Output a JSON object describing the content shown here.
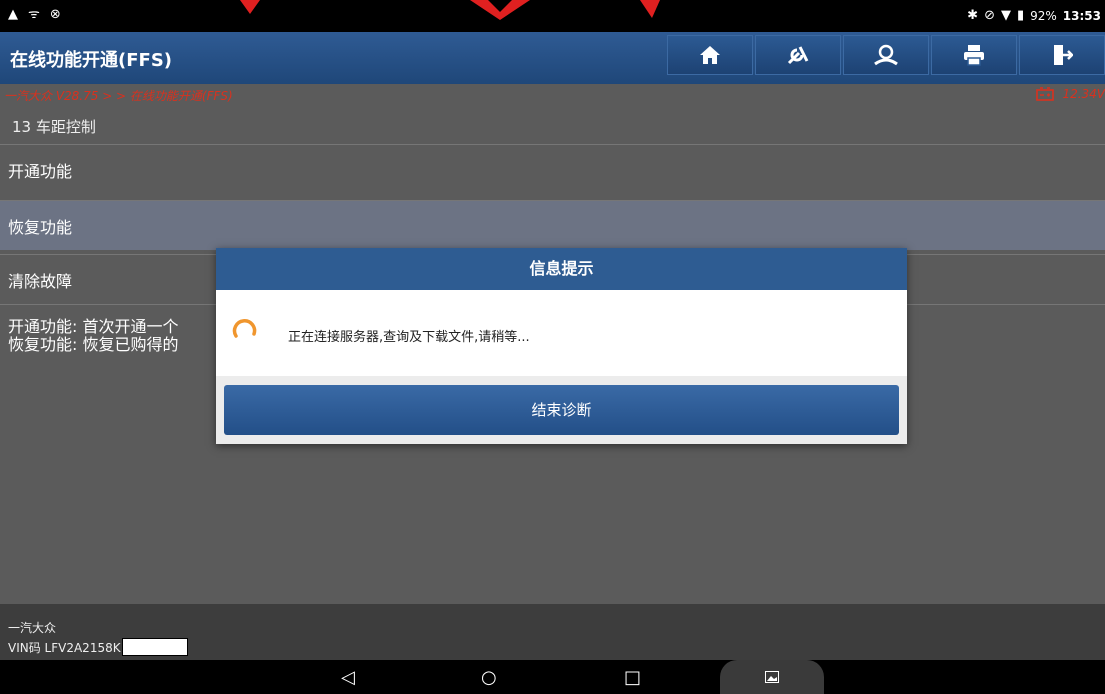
{
  "status_bar": {
    "battery_percent": "92%",
    "time": "13:53",
    "left_icons": [
      "warning-icon",
      "usb-icon",
      "no-disturb-icon"
    ],
    "right_icons": [
      "bluetooth-icon",
      "no-signal-icon",
      "wifi-icon",
      "battery-icon"
    ]
  },
  "header": {
    "title": "在线功能开通(FFS)",
    "tools": [
      "home-icon",
      "diagnose-icon",
      "user-icon",
      "print-icon",
      "exit-icon"
    ]
  },
  "breadcrumb": {
    "path": "一汽大众 V28.75 > > 在线功能开通(FFS)",
    "voltage": "12.34V"
  },
  "section": {
    "title": "13 车距控制"
  },
  "menu": {
    "items": [
      {
        "label": "开通功能"
      },
      {
        "label": "恢复功能"
      },
      {
        "label": "清除故障"
      }
    ],
    "selected_index": 1
  },
  "description": {
    "line1": "开通功能: 首次开通一个",
    "line2": "恢复功能: 恢复已购得的"
  },
  "footer": {
    "make": "一汽大众",
    "vin": "VIN码 LFV2A2158K"
  },
  "dialog": {
    "title": "信息提示",
    "message": "正在连接服务器,查询及下载文件,请稍等...",
    "button_label": "结束诊断"
  },
  "nav": {
    "back": "◁",
    "home": "○",
    "recents": "□"
  },
  "colors": {
    "header_blue": "#2f5b94",
    "breadcrumb_red": "#d9311e",
    "spinner_orange": "#f0962e"
  }
}
